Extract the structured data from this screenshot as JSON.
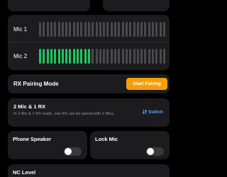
{
  "meters": {
    "mic1": {
      "label": "Mic 1",
      "total_segments": 34,
      "active_segments": 0
    },
    "mic2": {
      "label": "Mic 2",
      "total_segments": 34,
      "active_segments": 14
    }
  },
  "colors": {
    "active_bar": "#22c55e",
    "inactive_bar": "#4a4a4c",
    "accent": "#f59e0b",
    "link": "#5aa0ff"
  },
  "pairing": {
    "title": "RX Pairing Mode",
    "button_label": "Start Pairing"
  },
  "mode": {
    "title": "2 Mic & 1 RX",
    "description": "In 2 Mic & 1 RX mode, one RX can be paired with 2 Mics.",
    "switch_label": "Switch",
    "switch_icon": "swap-arrows-icon"
  },
  "toggles": {
    "phone_speaker": {
      "label": "Phone Speaker",
      "on": false
    },
    "lock_mic": {
      "label": "Lock Mic",
      "on": false
    }
  },
  "nc": {
    "title": "NC Level"
  }
}
